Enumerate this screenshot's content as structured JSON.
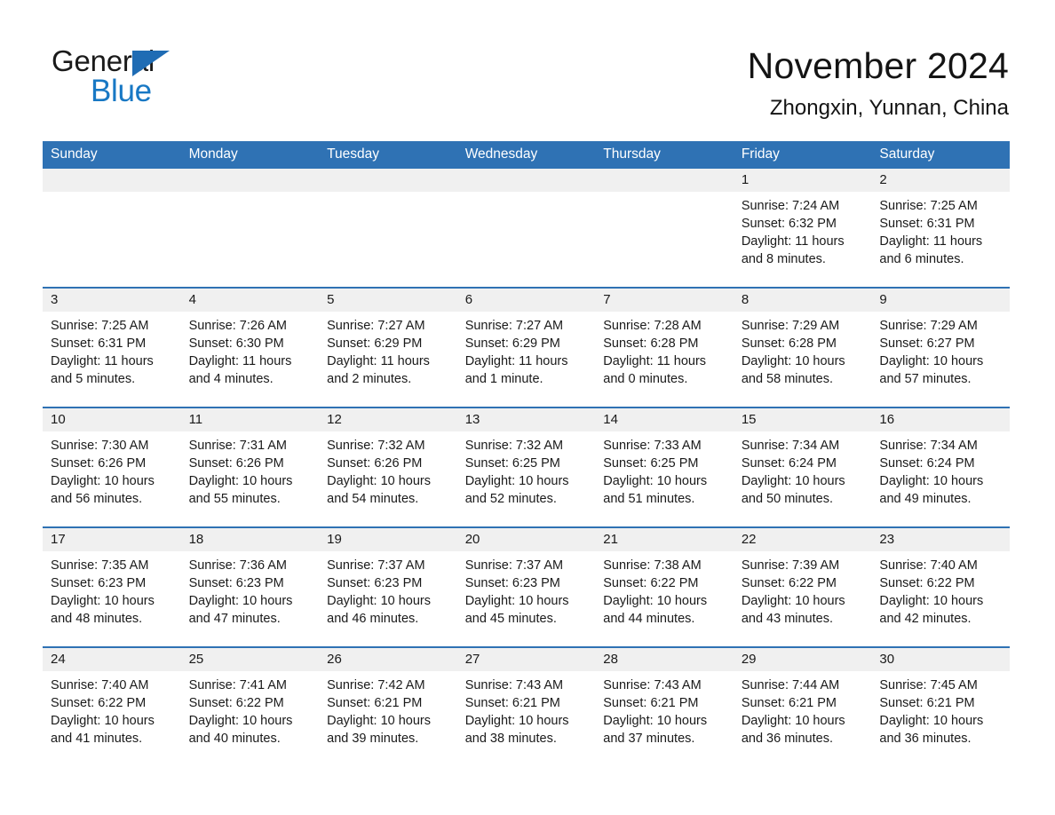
{
  "brand": {
    "name_part1": "General",
    "name_part2": "Blue",
    "accent_color": "#1878c4",
    "triangle_color": "#1f6cb4"
  },
  "header": {
    "title": "November 2024",
    "location": "Zhongxin, Yunnan, China"
  },
  "calendar": {
    "header_background": "#2f72b4",
    "daynum_band_background": "#f0f0f0",
    "weekday_headers": [
      "Sunday",
      "Monday",
      "Tuesday",
      "Wednesday",
      "Thursday",
      "Friday",
      "Saturday"
    ],
    "weeks": [
      [
        {
          "day": "",
          "sunrise": "",
          "sunset": "",
          "daylight_line1": "",
          "daylight_line2": ""
        },
        {
          "day": "",
          "sunrise": "",
          "sunset": "",
          "daylight_line1": "",
          "daylight_line2": ""
        },
        {
          "day": "",
          "sunrise": "",
          "sunset": "",
          "daylight_line1": "",
          "daylight_line2": ""
        },
        {
          "day": "",
          "sunrise": "",
          "sunset": "",
          "daylight_line1": "",
          "daylight_line2": ""
        },
        {
          "day": "",
          "sunrise": "",
          "sunset": "",
          "daylight_line1": "",
          "daylight_line2": ""
        },
        {
          "day": "1",
          "sunrise": "Sunrise: 7:24 AM",
          "sunset": "Sunset: 6:32 PM",
          "daylight_line1": "Daylight: 11 hours",
          "daylight_line2": "and 8 minutes."
        },
        {
          "day": "2",
          "sunrise": "Sunrise: 7:25 AM",
          "sunset": "Sunset: 6:31 PM",
          "daylight_line1": "Daylight: 11 hours",
          "daylight_line2": "and 6 minutes."
        }
      ],
      [
        {
          "day": "3",
          "sunrise": "Sunrise: 7:25 AM",
          "sunset": "Sunset: 6:31 PM",
          "daylight_line1": "Daylight: 11 hours",
          "daylight_line2": "and 5 minutes."
        },
        {
          "day": "4",
          "sunrise": "Sunrise: 7:26 AM",
          "sunset": "Sunset: 6:30 PM",
          "daylight_line1": "Daylight: 11 hours",
          "daylight_line2": "and 4 minutes."
        },
        {
          "day": "5",
          "sunrise": "Sunrise: 7:27 AM",
          "sunset": "Sunset: 6:29 PM",
          "daylight_line1": "Daylight: 11 hours",
          "daylight_line2": "and 2 minutes."
        },
        {
          "day": "6",
          "sunrise": "Sunrise: 7:27 AM",
          "sunset": "Sunset: 6:29 PM",
          "daylight_line1": "Daylight: 11 hours",
          "daylight_line2": "and 1 minute."
        },
        {
          "day": "7",
          "sunrise": "Sunrise: 7:28 AM",
          "sunset": "Sunset: 6:28 PM",
          "daylight_line1": "Daylight: 11 hours",
          "daylight_line2": "and 0 minutes."
        },
        {
          "day": "8",
          "sunrise": "Sunrise: 7:29 AM",
          "sunset": "Sunset: 6:28 PM",
          "daylight_line1": "Daylight: 10 hours",
          "daylight_line2": "and 58 minutes."
        },
        {
          "day": "9",
          "sunrise": "Sunrise: 7:29 AM",
          "sunset": "Sunset: 6:27 PM",
          "daylight_line1": "Daylight: 10 hours",
          "daylight_line2": "and 57 minutes."
        }
      ],
      [
        {
          "day": "10",
          "sunrise": "Sunrise: 7:30 AM",
          "sunset": "Sunset: 6:26 PM",
          "daylight_line1": "Daylight: 10 hours",
          "daylight_line2": "and 56 minutes."
        },
        {
          "day": "11",
          "sunrise": "Sunrise: 7:31 AM",
          "sunset": "Sunset: 6:26 PM",
          "daylight_line1": "Daylight: 10 hours",
          "daylight_line2": "and 55 minutes."
        },
        {
          "day": "12",
          "sunrise": "Sunrise: 7:32 AM",
          "sunset": "Sunset: 6:26 PM",
          "daylight_line1": "Daylight: 10 hours",
          "daylight_line2": "and 54 minutes."
        },
        {
          "day": "13",
          "sunrise": "Sunrise: 7:32 AM",
          "sunset": "Sunset: 6:25 PM",
          "daylight_line1": "Daylight: 10 hours",
          "daylight_line2": "and 52 minutes."
        },
        {
          "day": "14",
          "sunrise": "Sunrise: 7:33 AM",
          "sunset": "Sunset: 6:25 PM",
          "daylight_line1": "Daylight: 10 hours",
          "daylight_line2": "and 51 minutes."
        },
        {
          "day": "15",
          "sunrise": "Sunrise: 7:34 AM",
          "sunset": "Sunset: 6:24 PM",
          "daylight_line1": "Daylight: 10 hours",
          "daylight_line2": "and 50 minutes."
        },
        {
          "day": "16",
          "sunrise": "Sunrise: 7:34 AM",
          "sunset": "Sunset: 6:24 PM",
          "daylight_line1": "Daylight: 10 hours",
          "daylight_line2": "and 49 minutes."
        }
      ],
      [
        {
          "day": "17",
          "sunrise": "Sunrise: 7:35 AM",
          "sunset": "Sunset: 6:23 PM",
          "daylight_line1": "Daylight: 10 hours",
          "daylight_line2": "and 48 minutes."
        },
        {
          "day": "18",
          "sunrise": "Sunrise: 7:36 AM",
          "sunset": "Sunset: 6:23 PM",
          "daylight_line1": "Daylight: 10 hours",
          "daylight_line2": "and 47 minutes."
        },
        {
          "day": "19",
          "sunrise": "Sunrise: 7:37 AM",
          "sunset": "Sunset: 6:23 PM",
          "daylight_line1": "Daylight: 10 hours",
          "daylight_line2": "and 46 minutes."
        },
        {
          "day": "20",
          "sunrise": "Sunrise: 7:37 AM",
          "sunset": "Sunset: 6:23 PM",
          "daylight_line1": "Daylight: 10 hours",
          "daylight_line2": "and 45 minutes."
        },
        {
          "day": "21",
          "sunrise": "Sunrise: 7:38 AM",
          "sunset": "Sunset: 6:22 PM",
          "daylight_line1": "Daylight: 10 hours",
          "daylight_line2": "and 44 minutes."
        },
        {
          "day": "22",
          "sunrise": "Sunrise: 7:39 AM",
          "sunset": "Sunset: 6:22 PM",
          "daylight_line1": "Daylight: 10 hours",
          "daylight_line2": "and 43 minutes."
        },
        {
          "day": "23",
          "sunrise": "Sunrise: 7:40 AM",
          "sunset": "Sunset: 6:22 PM",
          "daylight_line1": "Daylight: 10 hours",
          "daylight_line2": "and 42 minutes."
        }
      ],
      [
        {
          "day": "24",
          "sunrise": "Sunrise: 7:40 AM",
          "sunset": "Sunset: 6:22 PM",
          "daylight_line1": "Daylight: 10 hours",
          "daylight_line2": "and 41 minutes."
        },
        {
          "day": "25",
          "sunrise": "Sunrise: 7:41 AM",
          "sunset": "Sunset: 6:22 PM",
          "daylight_line1": "Daylight: 10 hours",
          "daylight_line2": "and 40 minutes."
        },
        {
          "day": "26",
          "sunrise": "Sunrise: 7:42 AM",
          "sunset": "Sunset: 6:21 PM",
          "daylight_line1": "Daylight: 10 hours",
          "daylight_line2": "and 39 minutes."
        },
        {
          "day": "27",
          "sunrise": "Sunrise: 7:43 AM",
          "sunset": "Sunset: 6:21 PM",
          "daylight_line1": "Daylight: 10 hours",
          "daylight_line2": "and 38 minutes."
        },
        {
          "day": "28",
          "sunrise": "Sunrise: 7:43 AM",
          "sunset": "Sunset: 6:21 PM",
          "daylight_line1": "Daylight: 10 hours",
          "daylight_line2": "and 37 minutes."
        },
        {
          "day": "29",
          "sunrise": "Sunrise: 7:44 AM",
          "sunset": "Sunset: 6:21 PM",
          "daylight_line1": "Daylight: 10 hours",
          "daylight_line2": "and 36 minutes."
        },
        {
          "day": "30",
          "sunrise": "Sunrise: 7:45 AM",
          "sunset": "Sunset: 6:21 PM",
          "daylight_line1": "Daylight: 10 hours",
          "daylight_line2": "and 36 minutes."
        }
      ]
    ]
  }
}
